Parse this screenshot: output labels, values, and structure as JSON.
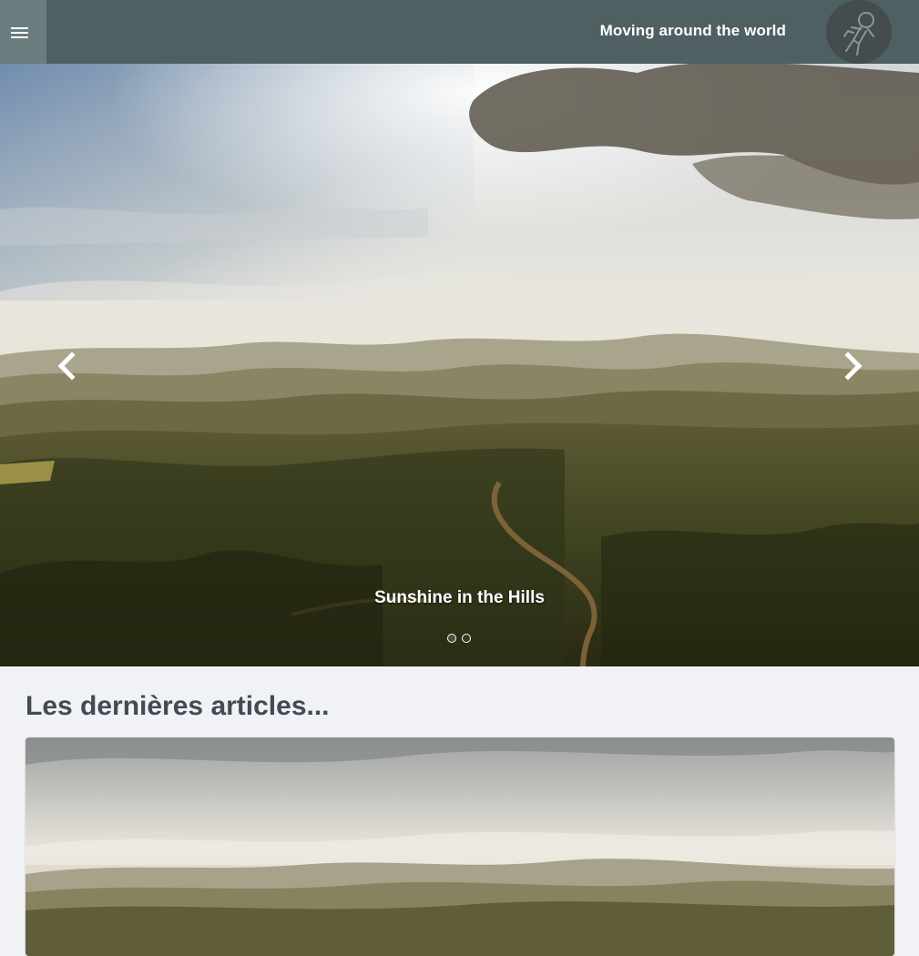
{
  "header": {
    "site_title": "Moving around the world",
    "menu_icon": "hamburger-menu-icon",
    "avatar_icon": "astronaut-icon"
  },
  "carousel": {
    "slide_caption": "Sunshine in the Hills",
    "slide_count": 2,
    "active_slide": 1,
    "prev_icon": "chevron-left-icon",
    "next_icon": "chevron-right-icon"
  },
  "articles": {
    "heading": "Les dernières articles..."
  },
  "colors": {
    "header_bg": "#4e6062",
    "menu_button_bg": "#6a7c7d",
    "page_bg": "#f0f2f5",
    "heading_text": "#424a55"
  }
}
